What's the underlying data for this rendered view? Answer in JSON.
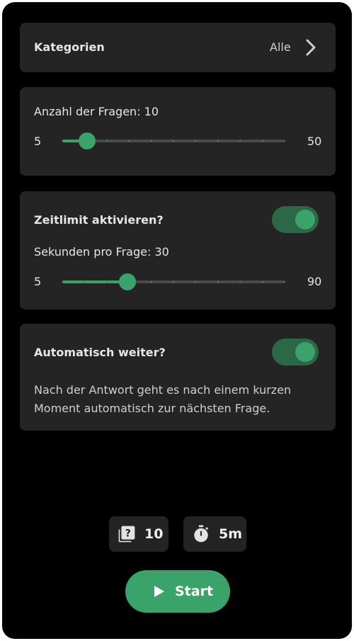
{
  "categories": {
    "label": "Kategorien",
    "value": "Alle"
  },
  "questions": {
    "label": "Anzahl der Fragen: 10",
    "min": "5",
    "max": "50",
    "value": 10
  },
  "timelimit": {
    "label": "Zeitlimit aktivieren?",
    "enabled": true,
    "seconds_label": "Sekunden pro Frage: 30",
    "min": "5",
    "max": "90",
    "value": 30
  },
  "auto_next": {
    "label": "Automatisch weiter?",
    "enabled": true,
    "description_line1": "Nach der Antwort geht es nach einem kurzen",
    "description_line2": "Moment automatisch zur nächsten Frage."
  },
  "summary": {
    "questions_count": "10",
    "questions_icon": "question-stack-icon",
    "time": "5m",
    "time_icon": "stopwatch-icon"
  },
  "start_button": {
    "label": "Start",
    "icon": "play-icon"
  },
  "colors": {
    "accent": "#3aa36a",
    "switch_track": "#2c6848",
    "card": "#242424",
    "background": "#000000"
  }
}
